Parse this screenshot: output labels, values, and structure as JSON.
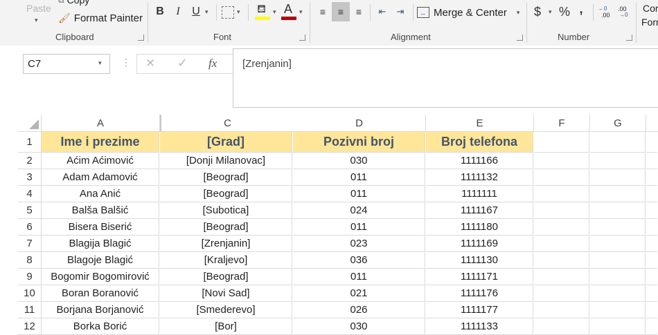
{
  "ribbon": {
    "paste_label": "Paste",
    "copy_label": "Copy",
    "format_painter_label": "Format Painter",
    "clipboard_group": "Clipboard",
    "font_group": "Font",
    "alignment_group": "Alignment",
    "number_group": "Number",
    "bold": "B",
    "italic": "I",
    "underline": "U",
    "merge_center_label": "Merge & Center",
    "currency_symbol": "$",
    "percent_symbol": "%",
    "comma_symbol": ",",
    "increase_decimal": ".00",
    "decrease_decimal": ".00",
    "cond_format_partial_1": "Cor",
    "cond_format_partial_2": "Forr",
    "font_color": "#c00000",
    "fill_color": "#ffff00"
  },
  "formula_bar": {
    "name_box": "C7",
    "cancel_icon": "✕",
    "enter_icon": "✓",
    "fx_label": "fx",
    "formula": "[Zrenjanin]"
  },
  "columns": [
    "A",
    "C",
    "D",
    "E",
    "F",
    "G"
  ],
  "rows": [
    {
      "num": "1",
      "cells": [
        "Ime i prezime",
        "[Grad]",
        "Pozivni broj",
        "Broj telefona"
      ]
    },
    {
      "num": "2",
      "cells": [
        "Aćim Aćimović",
        "[Donji Milanovac]",
        "030",
        "1111166"
      ]
    },
    {
      "num": "3",
      "cells": [
        "Adam Adamović",
        "[Beograd]",
        "011",
        "1111132"
      ]
    },
    {
      "num": "4",
      "cells": [
        "Ana Anić",
        "[Beograd]",
        "011",
        "1111111"
      ]
    },
    {
      "num": "5",
      "cells": [
        "Balša Balšić",
        "[Subotica]",
        "024",
        "1111167"
      ]
    },
    {
      "num": "6",
      "cells": [
        "Bisera Biserić",
        "[Beograd]",
        "011",
        "1111180"
      ]
    },
    {
      "num": "7",
      "cells": [
        "Blagija Blagić",
        "[Zrenjanin]",
        "023",
        "1111169"
      ]
    },
    {
      "num": "8",
      "cells": [
        "Blagoje Blagić",
        "[Kraljevo]",
        "036",
        "1111130"
      ]
    },
    {
      "num": "9",
      "cells": [
        "Bogomir Bogomirović",
        "[Beograd]",
        "011",
        "1111171"
      ]
    },
    {
      "num": "10",
      "cells": [
        "Boran Boranović",
        "[Novi Sad]",
        "021",
        "1111176"
      ]
    },
    {
      "num": "11",
      "cells": [
        "Borjana Borjanović",
        "[Smederevo]",
        "026",
        "1111177"
      ]
    },
    {
      "num": "12",
      "cells": [
        "Borka Borić",
        "[Bor]",
        "030",
        "1111133"
      ]
    }
  ]
}
